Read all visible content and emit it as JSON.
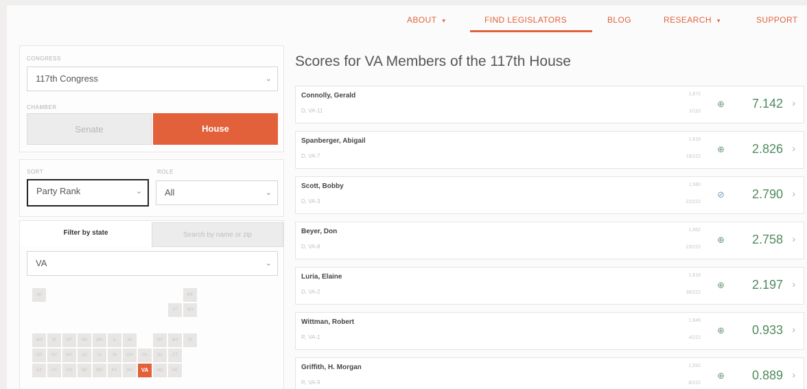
{
  "nav": {
    "items": [
      {
        "label": "ABOUT",
        "caret": "▾"
      },
      {
        "label": "FIND LEGISLATORS",
        "caret": ""
      },
      {
        "label": "BLOG",
        "caret": ""
      },
      {
        "label": "RESEARCH",
        "caret": "▾"
      },
      {
        "label": "SUPPORT",
        "caret": ""
      }
    ]
  },
  "filters": {
    "congress_label": "CONGRESS",
    "congress_value": "117th Congress",
    "chamber_label": "CHAMBER",
    "chamber_options": [
      "Senate",
      "House"
    ],
    "chamber_selected": "House",
    "sort_label": "SORT",
    "sort_value": "Party Rank",
    "role_label": "ROLE",
    "role_value": "All",
    "tabs": [
      "Filter by state",
      "Search by name or zip"
    ],
    "state_value": "VA"
  },
  "state_map": {
    "rows": [
      [
        "AK",
        "",
        "",
        "",
        "",
        "",
        "",
        "",
        "",
        "",
        "ME"
      ],
      [
        "",
        "",
        "",
        "",
        "",
        "",
        "",
        "",
        "",
        "VT",
        "NH"
      ],
      [
        "",
        "",
        "",
        "",
        "",
        "",
        "",
        "",
        "",
        "",
        ""
      ],
      [
        "WA",
        "ID",
        "MT",
        "ND",
        "MN",
        "IL",
        "MI",
        "",
        "NY",
        "MA",
        "RI"
      ],
      [
        "OR",
        "NV",
        "WY",
        "SD",
        "IA",
        "IN",
        "OH",
        "PA",
        "NJ",
        "CT",
        ""
      ],
      [
        "CA",
        "UT",
        "CO",
        "NE",
        "MO",
        "KY",
        "WV",
        "VA",
        "MD",
        "DE",
        ""
      ]
    ],
    "selected": "VA"
  },
  "main": {
    "title": "Scores for VA Members of the 117th House"
  },
  "members": [
    {
      "name": "Connolly, Gerald",
      "district": "D, VA-11",
      "stat1": "1,672",
      "stat2": "1/110",
      "status": "⊕",
      "status_color": "green",
      "score": "7.142"
    },
    {
      "name": "Spanberger, Abigail",
      "district": "D, VA-7",
      "stat1": "1,616",
      "stat2": "19/222",
      "status": "⊕",
      "status_color": "green",
      "score": "2.826"
    },
    {
      "name": "Scott, Bobby",
      "district": "D, VA-3",
      "stat1": "1,580",
      "stat2": "22/222",
      "status": "⊘",
      "status_color": "blue",
      "score": "2.790"
    },
    {
      "name": "Beyer, Don",
      "district": "D, VA-8",
      "stat1": "1,562",
      "stat2": "23/222",
      "status": "⊕",
      "status_color": "green",
      "score": "2.758"
    },
    {
      "name": "Luria, Elaine",
      "district": "D, VA-2",
      "stat1": "1,616",
      "stat2": "36/222",
      "status": "⊕",
      "status_color": "green",
      "score": "2.197"
    },
    {
      "name": "Wittman, Robert",
      "district": "R, VA-1",
      "stat1": "1,646",
      "stat2": "4/222",
      "status": "⊕",
      "status_color": "green",
      "score": "0.933"
    },
    {
      "name": "Griffith, H. Morgan",
      "district": "R, VA-9",
      "stat1": "1,592",
      "stat2": "8/222",
      "status": "⊕",
      "status_color": "green",
      "score": "0.889"
    }
  ],
  "colors": {
    "accent": "#e2603a",
    "score_green": "#4f8a5d",
    "status_blue": "#7a9fb8"
  }
}
